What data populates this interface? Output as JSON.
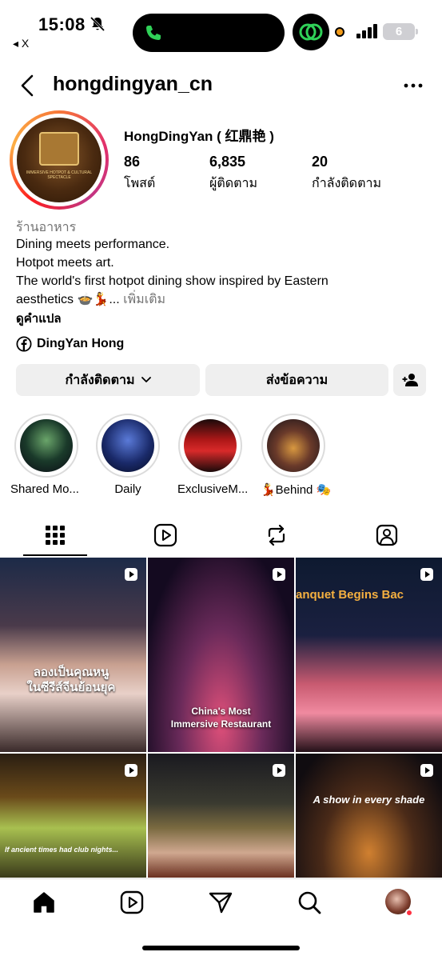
{
  "status_bar": {
    "time": "15:08",
    "back_app": "◂ X",
    "battery": "6"
  },
  "header": {
    "username": "hongdingyan_cn"
  },
  "profile": {
    "display_name": "HongDingYan ( 红鼎艳 )",
    "stats": [
      {
        "value": "86",
        "label": "โพสต์"
      },
      {
        "value": "6,835",
        "label": "ผู้ติดตาม"
      },
      {
        "value": "20",
        "label": "กำลังติดตาม"
      }
    ],
    "category": "ร้านอาหาร",
    "bio_lines": [
      "Dining meets performance.",
      "Hotpot meets art.",
      "The world's first hotpot dining show inspired by Eastern",
      "aesthetics 🍲💃"
    ],
    "bio_ellipsis": "...",
    "more": "เพิ่มเติม",
    "translate": "ดูคำแปล",
    "link_label": "DingYan Hong",
    "avatar_text": "IMMERSIVE HOTPOT & CULTURAL SPECTACLE"
  },
  "buttons": {
    "following": "กำลังติดตาม",
    "message": "ส่งข้อความ"
  },
  "highlights": [
    {
      "label": "Shared Mo..."
    },
    {
      "label": "Daily"
    },
    {
      "label": "ExclusiveM..."
    },
    {
      "label": "💃Behind 🎭"
    }
  ],
  "grid_posts": [
    {
      "caption": "ลองเป็นคุณหนู\nในซีรีส์จีนย้อนยุค"
    },
    {
      "caption": "China's Most\nImmersive Restaurant"
    },
    {
      "caption": "anquet Begins Bac"
    },
    {
      "caption": "If ancient times had club nights..."
    },
    {
      "caption": ""
    },
    {
      "caption": "A show in every shade"
    }
  ],
  "colors": {
    "muted": "#737373",
    "button_bg": "#efefef",
    "accent_orange": "#f29b19",
    "notification_red": "#ff3040"
  }
}
